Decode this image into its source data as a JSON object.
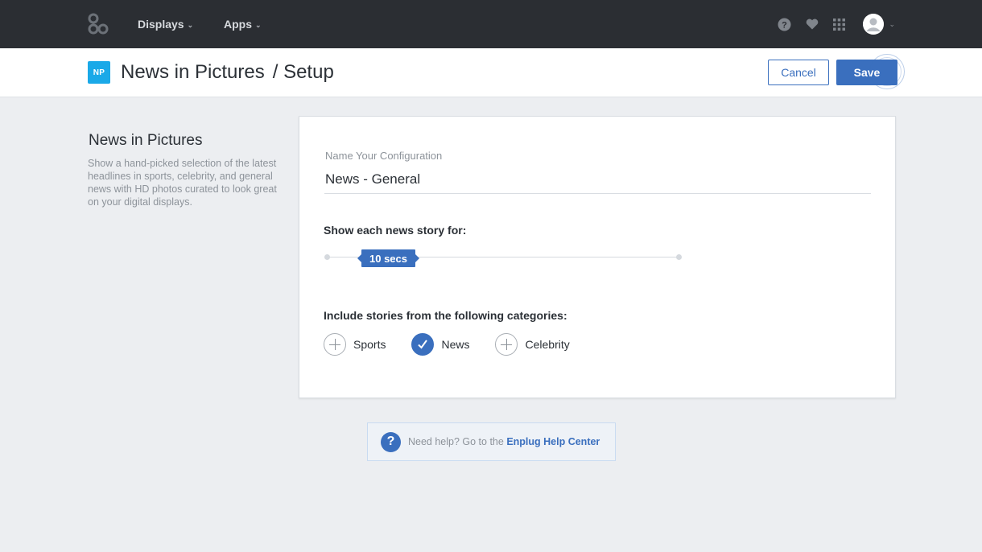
{
  "topnav": {
    "displays_label": "Displays",
    "apps_label": "Apps"
  },
  "header": {
    "badge": "NP",
    "title": "News in Pictures",
    "subtitle": "/ Setup",
    "cancel_label": "Cancel",
    "save_label": "Save"
  },
  "sidebar": {
    "title": "News in Pictures",
    "description": "Show a hand-picked selection of the latest headlines in sports, celebrity, and general news with HD photos curated to look great on your digital displays."
  },
  "form": {
    "name_label": "Name Your Configuration",
    "name_value": "News - General",
    "duration_label": "Show each news story for:",
    "duration_value": "10 secs",
    "categories_label": "Include stories from the following categories:",
    "categories": [
      {
        "label": "Sports",
        "checked": false
      },
      {
        "label": "News",
        "checked": true
      },
      {
        "label": "Celebrity",
        "checked": false
      }
    ]
  },
  "help": {
    "text": "Need help? Go to the ",
    "link": "Enplug Help Center",
    "icon": "?"
  },
  "colors": {
    "accent": "#3a6fbe",
    "badge": "#1aa9e8",
    "nav_bg": "#2b2e33",
    "page_bg": "#eceef1"
  },
  "icons": [
    "logo-icon",
    "help-icon",
    "heart-icon",
    "grid-icon",
    "avatar-icon",
    "chevron-down-icon",
    "plus-icon",
    "check-icon"
  ]
}
